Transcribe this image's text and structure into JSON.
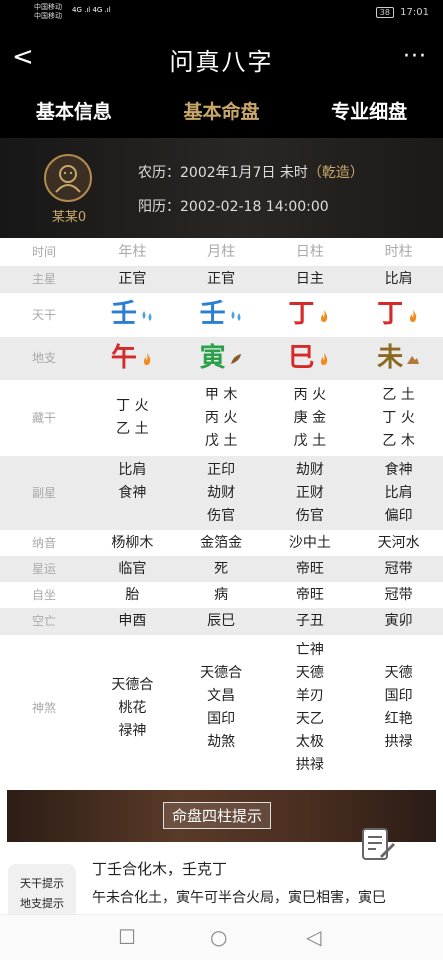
{
  "status": {
    "carrier1": "中国移动",
    "carrier2": "中国移动",
    "signal": "4G .ıl 4G .ıl",
    "battery": "38",
    "time": "17:01"
  },
  "nav": {
    "back": "<",
    "title": "问真八字",
    "more": "···"
  },
  "tabs": [
    {
      "label": "基本信息",
      "active": false
    },
    {
      "label": "基本命盘",
      "active": true
    },
    {
      "label": "专业细盘",
      "active": false
    }
  ],
  "profile": {
    "name": "某某0",
    "lunar_label": "农历：",
    "lunar_value": "2002年1月7日 未时",
    "lunar_tag": "（乾造）",
    "solar_label": "阳历：",
    "solar_value": "2002-02-18 14:00:00"
  },
  "table": {
    "header": [
      "时间",
      "年柱",
      "月柱",
      "日柱",
      "时柱"
    ],
    "zhuxing": {
      "label": "主星",
      "cells": [
        "正官",
        "正官",
        "日主",
        "比肩"
      ]
    },
    "tiangan": {
      "label": "天干",
      "cells": [
        {
          "char": "壬",
          "color": "#2a7fd4",
          "icon": "water-icon"
        },
        {
          "char": "壬",
          "color": "#2a7fd4",
          "icon": "water-icon"
        },
        {
          "char": "丁",
          "color": "#d42a2a",
          "icon": "fire-icon"
        },
        {
          "char": "丁",
          "color": "#d42a2a",
          "icon": "fire-icon"
        }
      ]
    },
    "dizhi": {
      "label": "地支",
      "cells": [
        {
          "char": "午",
          "color": "#d42a2a",
          "icon": "fire-icon"
        },
        {
          "char": "寅",
          "color": "#2aa04a",
          "icon": "wood-icon"
        },
        {
          "char": "巳",
          "color": "#d42a2a",
          "icon": "fire-icon"
        },
        {
          "char": "未",
          "color": "#8a6a20",
          "icon": "earth-icon"
        }
      ]
    },
    "canggan": {
      "label": "藏干",
      "cells": [
        [
          "丁 火",
          "乙 土"
        ],
        [
          "甲 木",
          "丙 火",
          "戊 土"
        ],
        [
          "丙 火",
          "庚 金",
          "戊 土"
        ],
        [
          "乙 土",
          "丁 火",
          "乙 木"
        ]
      ]
    },
    "fuxing": {
      "label": "副星",
      "cells": [
        [
          "比肩",
          "食神"
        ],
        [
          "正印",
          "劫财",
          "伤官"
        ],
        [
          "劫财",
          "正财",
          "伤官"
        ],
        [
          "食神",
          "比肩",
          "偏印"
        ]
      ]
    },
    "nayin": {
      "label": "纳音",
      "cells": [
        "杨柳木",
        "金箔金",
        "沙中土",
        "天河水"
      ]
    },
    "xingyun": {
      "label": "星运",
      "cells": [
        "临官",
        "死",
        "帝旺",
        "冠带"
      ]
    },
    "zizuo": {
      "label": "自坐",
      "cells": [
        "胎",
        "病",
        "帝旺",
        "冠带"
      ]
    },
    "kongwang": {
      "label": "空亡",
      "cells": [
        "申酉",
        "辰巳",
        "子丑",
        "寅卯"
      ]
    },
    "shensha": {
      "label": "神煞",
      "cells": [
        [
          "天德合",
          "桃花",
          "禄神"
        ],
        [
          "天德合",
          "文昌",
          "国印",
          "劫煞"
        ],
        [
          "亡神",
          "天德",
          "羊刃",
          "天乙",
          "太极",
          "拱禄"
        ],
        [
          "天德",
          "国印",
          "红艳",
          "拱禄"
        ]
      ]
    }
  },
  "banner": {
    "text": "命盘四柱提示"
  },
  "hints": {
    "btn1": "天干提示",
    "btn2": "地支提示",
    "line1": "丁壬合化木，壬克丁",
    "line2": "午未合化土，寅午可半合火局，寅巳相害，寅巳"
  },
  "colors": {
    "accent": "#c9a76a",
    "header_bg": "#000000",
    "row_gray": "#ebebeb"
  }
}
